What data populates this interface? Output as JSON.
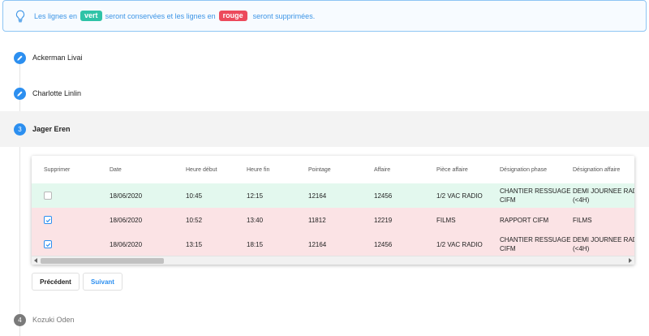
{
  "banner": {
    "text_1": "Les lignes en",
    "badge_green": "vert",
    "text_2": "seront conservées et les lignes en",
    "badge_red": "rouge",
    "text_3": "seront supprimées."
  },
  "steps": [
    {
      "label": "Ackerman Livai",
      "state": "done",
      "icon": "pencil-icon"
    },
    {
      "label": "Charlotte Linlin",
      "state": "done",
      "icon": "pencil-icon"
    },
    {
      "label": "Jager Eren",
      "state": "active",
      "number": "3"
    },
    {
      "label": "Kozuki Oden",
      "state": "pending",
      "number": "4"
    }
  ],
  "table": {
    "columns": [
      "Supprimer",
      "Date",
      "Heure début",
      "Heure fin",
      "Pointage",
      "Affaire",
      "Pièce affaire",
      "Désignation phase",
      "Désignation affaire"
    ],
    "rows": [
      {
        "checked": false,
        "status": "keep",
        "date": "18/06/2020",
        "start": "10:45",
        "end": "12:15",
        "pointage": "12164",
        "affaire": "12456",
        "piece": "1/2 VAC RADIO",
        "phase_l1": "CHANTIER RESSUAGE",
        "phase_l2": "CIFM",
        "aff_l1": "DEMI JOURNEE RAD",
        "aff_l2": "(<4H)"
      },
      {
        "checked": true,
        "status": "delete",
        "date": "18/06/2020",
        "start": "10:52",
        "end": "13:40",
        "pointage": "11812",
        "affaire": "12219",
        "piece": "FILMS",
        "phase_l1": "RAPPORT CIFM",
        "phase_l2": "",
        "aff_l1": "FILMS",
        "aff_l2": ""
      },
      {
        "checked": true,
        "status": "delete",
        "date": "18/06/2020",
        "start": "13:15",
        "end": "18:15",
        "pointage": "12164",
        "affaire": "12456",
        "piece": "1/2 VAC RADIO",
        "phase_l1": "CHANTIER RESSUAGE",
        "phase_l2": "CIFM",
        "aff_l1": "DEMI JOURNEE RAD",
        "aff_l2": "(<4H)"
      }
    ]
  },
  "buttons": {
    "previous": "Précédent",
    "next": "Suivant"
  },
  "colors": {
    "accent": "#2c8ff0",
    "keep_row": "#e3f8ee",
    "delete_row": "#fbe3e5",
    "badge_green": "#2fc3a7",
    "badge_red": "#ec4a5c"
  }
}
